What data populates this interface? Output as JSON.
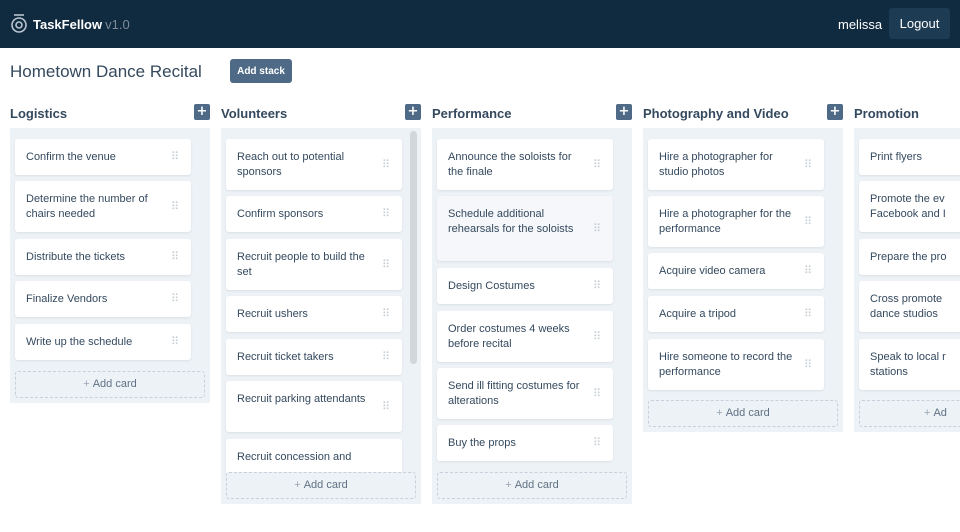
{
  "app": {
    "name": "TaskFellow",
    "version": "v1.0",
    "user": "melissa",
    "logout_label": "Logout"
  },
  "board": {
    "title": "Hometown Dance Recital",
    "add_stack_label": "Add stack"
  },
  "add_card_label": "Add card",
  "icons": {
    "logo": "taskfellow-logo-icon",
    "add": "plus-icon",
    "drag": "drag-handle-icon"
  },
  "colors": {
    "topbar": "#102a3f",
    "button": "#4f6a86",
    "stack_bg": "#edf2f7"
  },
  "stacks": [
    {
      "title": "Logistics",
      "cards": [
        "Confirm the venue",
        "Determine the number of chairs needed",
        "Distribute the tickets",
        "Finalize Vendors",
        "Write up the schedule"
      ]
    },
    {
      "title": "Volunteers",
      "cards": [
        "Reach out to potential sponsors",
        "Confirm sponsors",
        "Recruit people to build the set",
        "Recruit ushers",
        "Recruit ticket takers",
        "Recruit parking attendants",
        "Recruit concession and"
      ]
    },
    {
      "title": "Performance",
      "cards": [
        "Announce the soloists for the finale",
        "Schedule additional rehearsals for the soloists",
        "Design Costumes",
        "Order costumes 4 weeks before recital",
        "Send ill fitting costumes for alterations",
        "Buy the props"
      ]
    },
    {
      "title": "Photography and Video",
      "cards": [
        "Hire a photographer for studio photos",
        "Hire a photographer for the performance",
        "Acquire video camera",
        "Acquire a tripod",
        "Hire someone to record the performance"
      ]
    },
    {
      "title": "Promotion",
      "cards": [
        "Print flyers",
        "Promote the ev",
        "Facebook and I",
        "Prepare the pro",
        "Cross promote",
        "dance studios",
        "Speak to local r",
        "stations",
        "Ad"
      ]
    }
  ]
}
